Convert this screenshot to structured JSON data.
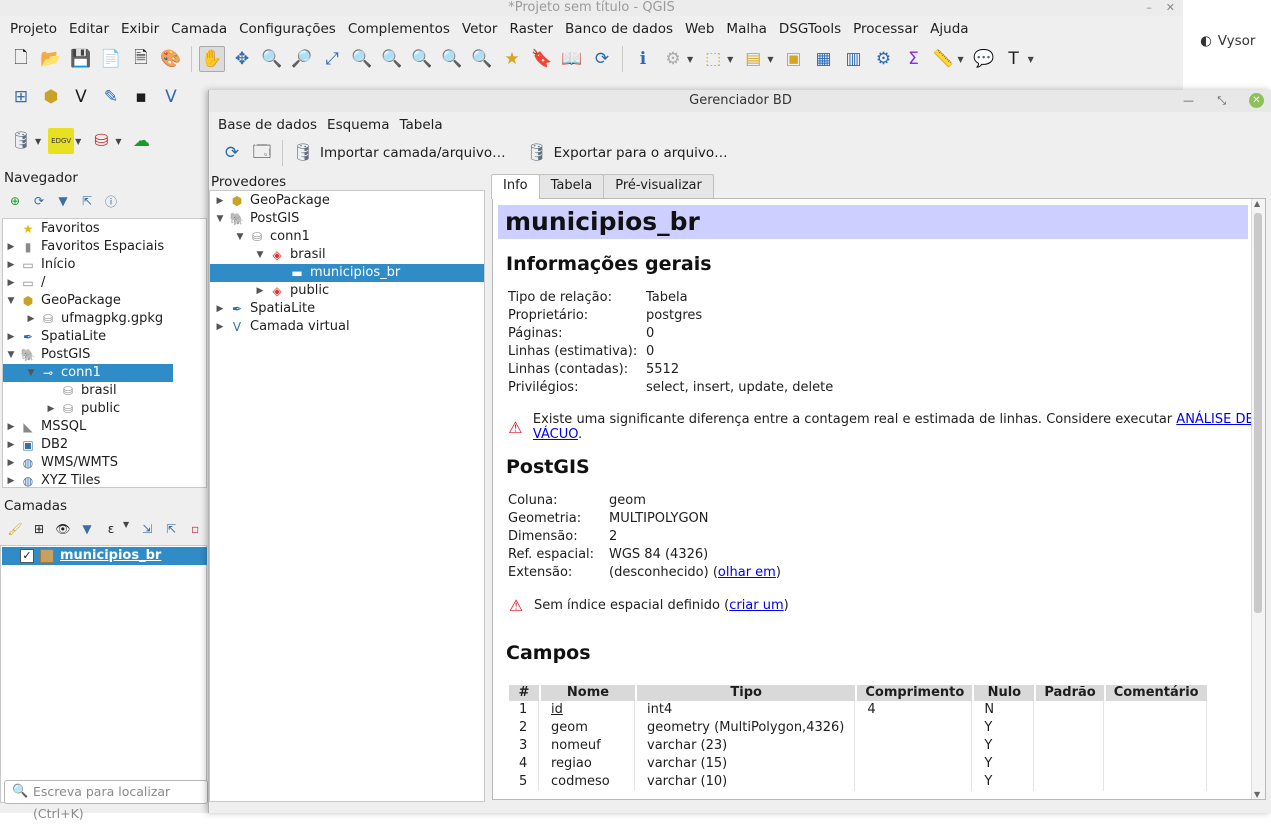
{
  "qgis": {
    "title": "*Projeto sem título - QGIS",
    "menu": [
      "Projeto",
      "Editar",
      "Exibir",
      "Camada",
      "Configurações",
      "Complementos",
      "Vetor",
      "Raster",
      "Banco de dados",
      "Web",
      "Malha",
      "DSGTools",
      "Processar",
      "Ajuda"
    ],
    "vysor": "Vysor",
    "navigator": {
      "header": "Navegador",
      "items": [
        {
          "label": "Favoritos",
          "icon": "star-icon"
        },
        {
          "label": "Favoritos Espaciais",
          "icon": "bookmark-icon"
        },
        {
          "label": "Início",
          "icon": "folder-icon"
        },
        {
          "label": "/",
          "icon": "folder-icon"
        },
        {
          "label": "GeoPackage",
          "icon": "geopackage-icon"
        },
        {
          "label": "ufmagpkg.gpkg",
          "icon": "database-icon"
        },
        {
          "label": "SpatiaLite",
          "icon": "feather-icon"
        },
        {
          "label": "PostGIS",
          "icon": "elephant-icon"
        },
        {
          "label": "conn1",
          "icon": "connection-icon"
        },
        {
          "label": "brasil",
          "icon": "schema-icon"
        },
        {
          "label": "public",
          "icon": "schema-icon"
        },
        {
          "label": "MSSQL",
          "icon": "mssql-icon"
        },
        {
          "label": "DB2",
          "icon": "db2-icon"
        },
        {
          "label": "WMS/WMTS",
          "icon": "globe-icon"
        },
        {
          "label": "XYZ Tiles",
          "icon": "globe-icon"
        }
      ]
    },
    "layers": {
      "header": "Camadas",
      "items": [
        {
          "label": "municipios_br",
          "checked": true
        }
      ]
    },
    "search_placeholder": "Escreva para localizar (Ctrl+K)"
  },
  "dbmanager": {
    "title": "Gerenciador BD",
    "menu": [
      "Base de dados",
      "Esquema",
      "Tabela"
    ],
    "toolbar": {
      "import_label": "Importar camada/arquivo…",
      "export_label": "Exportar para o arquivo…"
    },
    "providers_header": "Provedores",
    "providers": [
      {
        "label": "GeoPackage"
      },
      {
        "label": "PostGIS"
      },
      {
        "label": "conn1"
      },
      {
        "label": "brasil"
      },
      {
        "label": "municipios_br"
      },
      {
        "label": "public"
      },
      {
        "label": "SpatiaLite"
      },
      {
        "label": "Camada virtual"
      }
    ],
    "tabs": [
      "Info",
      "Tabela",
      "Pré-visualizar"
    ],
    "info": {
      "table_name": "municipios_br",
      "general_header": "Informações gerais",
      "general": [
        {
          "k": "Tipo de relação:",
          "v": "Tabela"
        },
        {
          "k": "Proprietário:",
          "v": "postgres"
        },
        {
          "k": "Páginas:",
          "v": "0"
        },
        {
          "k": "Linhas (estimativa):",
          "v": "0"
        },
        {
          "k": "Linhas (contadas):",
          "v": "5512"
        },
        {
          "k": "Privilégios:",
          "v": "select, insert, update, delete"
        }
      ],
      "warn_rows_text": "Existe uma significante diferença entre a contagem real e estimada de linhas. Considere executar",
      "warn_rows_link": "ANÁLISE DE VÁCUO",
      "postgis_header": "PostGIS",
      "postgis": [
        {
          "k": "Coluna:",
          "v": "geom"
        },
        {
          "k": "Geometria:",
          "v": "MULTIPOLYGON"
        },
        {
          "k": "Dimensão:",
          "v": "2"
        },
        {
          "k": "Ref. espacial:",
          "v": "WGS 84 (4326)"
        }
      ],
      "extent_key": "Extensão:",
      "extent_value": "(desconhecido) (",
      "extent_link": "olhar em",
      "warn_index_text": "Sem índice espacial definido (",
      "warn_index_link": "criar um",
      "fields_header": "Campos",
      "columns": [
        "#",
        "Nome",
        "Tipo",
        "Comprimento",
        "Nulo",
        "Padrão",
        "Comentário"
      ],
      "rows": [
        [
          "1",
          "id",
          "int4",
          "4",
          "N",
          "",
          ""
        ],
        [
          "2",
          "geom",
          "geometry (MultiPolygon,4326)",
          "",
          "Y",
          "",
          ""
        ],
        [
          "3",
          "nomeuf",
          "varchar (23)",
          "",
          "Y",
          "",
          ""
        ],
        [
          "4",
          "regiao",
          "varchar (15)",
          "",
          "Y",
          "",
          ""
        ],
        [
          "5",
          "codmeso",
          "varchar (10)",
          "",
          "Y",
          "",
          ""
        ]
      ]
    }
  }
}
